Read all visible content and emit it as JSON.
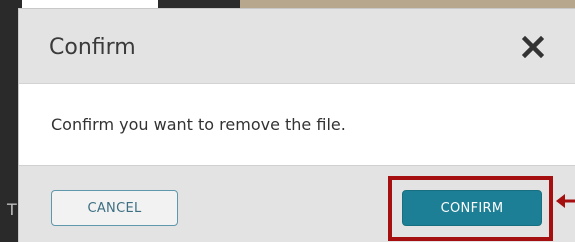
{
  "dialog": {
    "title": "Confirm",
    "close_icon": "close-icon",
    "message": "Confirm you want to remove the file.",
    "cancel_label": "CANCEL",
    "confirm_label": "CONFIRM"
  },
  "background": {
    "left_letter": "T"
  },
  "colors": {
    "confirm_button": "#1c7f95",
    "cancel_border": "#5f98ad",
    "highlight": "#a60f10",
    "header_bg": "#e3e3e3"
  }
}
